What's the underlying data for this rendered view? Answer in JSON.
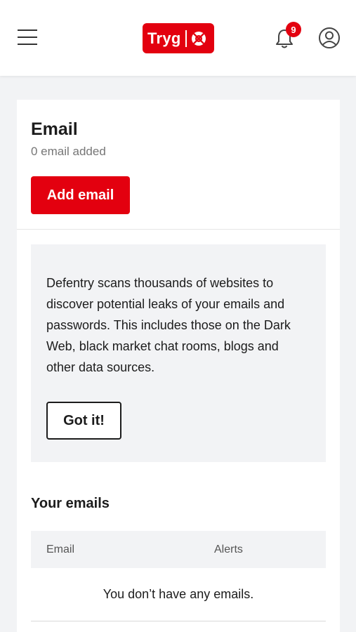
{
  "header": {
    "logo_text": "Tryg",
    "notification_count": "9",
    "brand_color": "#e3000f"
  },
  "email_section": {
    "title": "Email",
    "subtitle": "0 email added",
    "add_button_label": "Add email"
  },
  "info": {
    "text": "Defentry scans thousands of websites to discover potential leaks of your emails and passwords. This includes those on the Dark Web, black market chat rooms, blogs and other data sources.",
    "dismiss_label": "Got it!"
  },
  "your_emails": {
    "title": "Your emails",
    "columns": [
      "Email",
      "Alerts"
    ],
    "empty_message": "You don’t have any emails."
  }
}
